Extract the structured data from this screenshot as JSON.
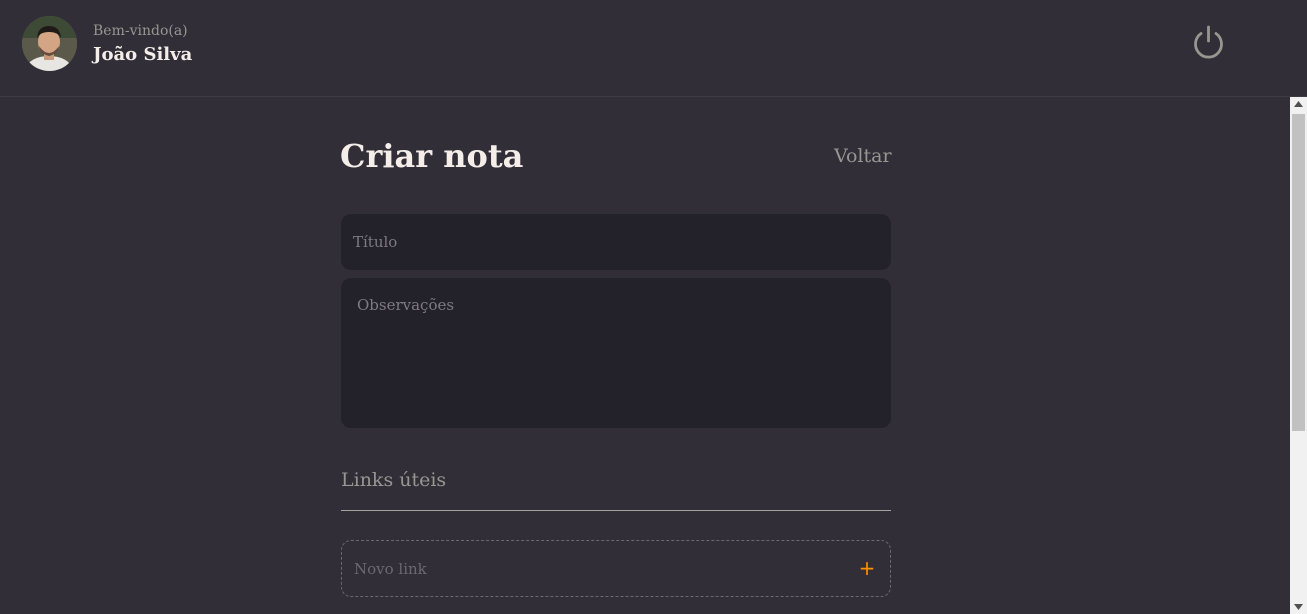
{
  "header": {
    "welcome": "Bem-vindo(a)",
    "username": "João Silva"
  },
  "form": {
    "title": "Criar nota",
    "back_label": "Voltar",
    "title_placeholder": "Título",
    "notes_placeholder": "Observações",
    "links_section_title": "Links úteis",
    "new_link_placeholder": "Novo link",
    "add_link_label": "+"
  },
  "colors": {
    "background": "#312e38",
    "input_background": "#232129",
    "accent": "#ff9000",
    "muted_text": "#999591"
  },
  "icons": {
    "power": "power-icon",
    "avatar": "avatar"
  }
}
